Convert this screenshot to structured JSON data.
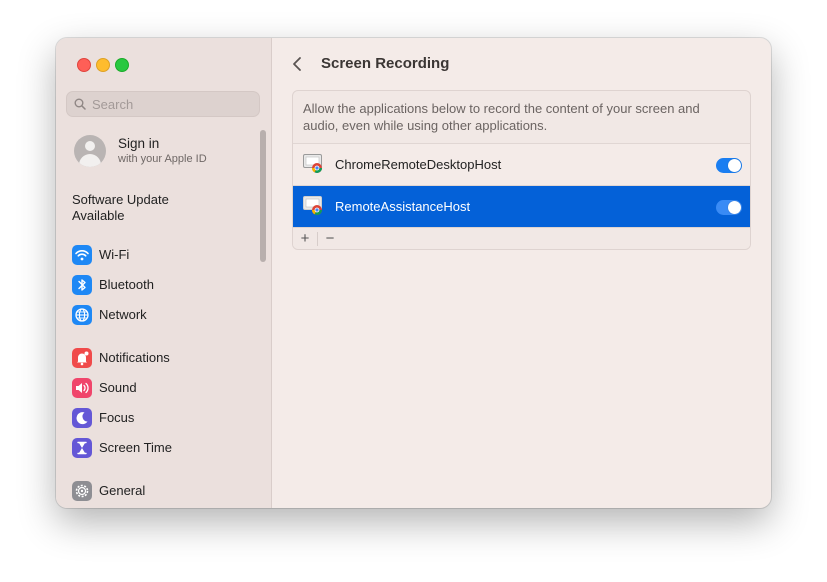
{
  "window": {
    "title": "Screen Recording"
  },
  "sidebar": {
    "search": {
      "placeholder": "Search",
      "value": ""
    },
    "profile": {
      "title": "Sign in",
      "subtitle": "with your Apple ID"
    },
    "update": "Software Update Available",
    "items": [
      {
        "label": "Wi-Fi",
        "icon": "wifi-icon",
        "color": "#1e88f5"
      },
      {
        "label": "Bluetooth",
        "icon": "bluetooth-icon",
        "color": "#1e88f5"
      },
      {
        "label": "Network",
        "icon": "globe-icon",
        "color": "#1e88f5"
      },
      {
        "label": "Notifications",
        "icon": "bell-icon",
        "color": "#f04a4a"
      },
      {
        "label": "Sound",
        "icon": "speaker-icon",
        "color": "#f0456b"
      },
      {
        "label": "Focus",
        "icon": "moon-icon",
        "color": "#6457d6"
      },
      {
        "label": "Screen Time",
        "icon": "hourglass-icon",
        "color": "#6457d6"
      },
      {
        "label": "General",
        "icon": "gear-icon",
        "color": "#8e8e93"
      }
    ]
  },
  "main": {
    "description": "Allow the applications below to record the content of your screen and audio, even while using other applications.",
    "apps": [
      {
        "name": "ChromeRemoteDesktopHost",
        "enabled": true,
        "selected": false
      },
      {
        "name": "RemoteAssistanceHost",
        "enabled": true,
        "selected": true
      }
    ],
    "add_label": "+",
    "remove_label": "−"
  },
  "colors": {
    "accent": "#0461d8",
    "toggle_on": "#1a7ef1"
  }
}
